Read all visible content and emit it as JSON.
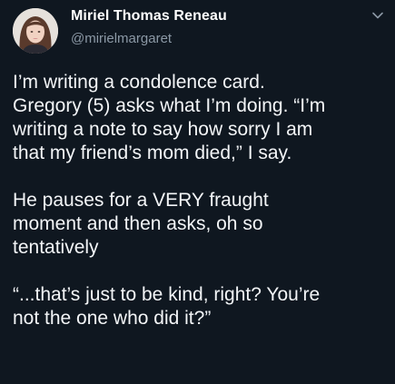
{
  "tweet": {
    "author": {
      "display_name": "Miriel Thomas Reneau",
      "handle": "@mirielmargaret",
      "avatar_icon": "profile-photo"
    },
    "menu_icon": "chevron-down-icon",
    "paragraphs": [
      {
        "lines": [
          "I’m writing a condolence card.",
          "Gregory (5) asks what I’m doing. “I’m",
          "writing a note to say how sorry I am",
          "that my friend’s mom died,” I say."
        ]
      },
      {
        "lines": [
          "He pauses for a VERY fraught",
          "moment and then asks, oh so",
          "tentatively"
        ]
      },
      {
        "lines": [
          "“...that’s just to be kind, right? You’re",
          "not the one who did it?”"
        ]
      }
    ]
  },
  "colors": {
    "background": "#0f1720",
    "text": "#f3f5f7",
    "secondary_text": "#8b98a5"
  }
}
